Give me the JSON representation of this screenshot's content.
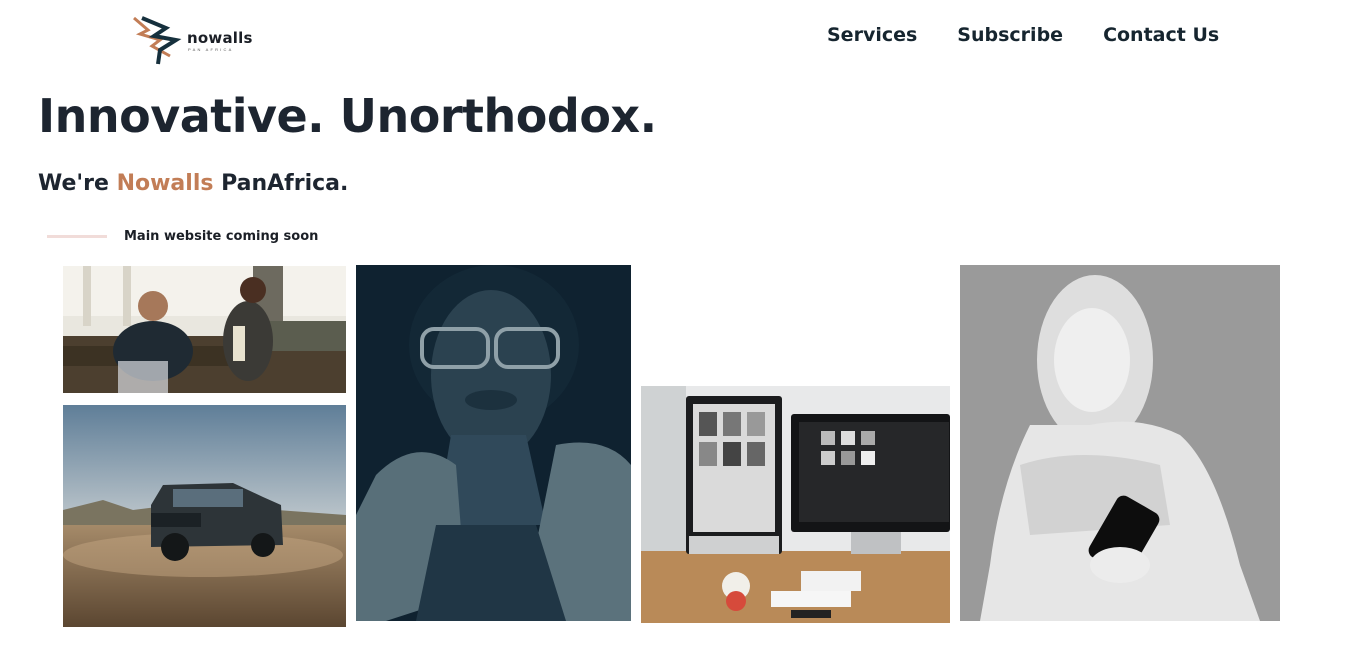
{
  "brand": {
    "name": "nowalls",
    "tagline": "PAN AFRICA"
  },
  "nav": {
    "items": [
      "Services",
      "Subscribe",
      "Contact Us"
    ]
  },
  "hero": {
    "headline": "Innovative. Unorthodox.",
    "sub_prefix": "We're ",
    "sub_accent": "Nowalls",
    "sub_suffix": " PanAfrica.",
    "notice": "Main website coming soon"
  },
  "colors": {
    "text": "#1d2530",
    "accent": "#c27d56",
    "divider": "#f1dcd9"
  },
  "gallery": [
    {
      "name": "office-meeting-image"
    },
    {
      "name": "suv-desert-image"
    },
    {
      "name": "portrait-woman-glasses-image"
    },
    {
      "name": "desk-monitors-image"
    },
    {
      "name": "statue-phone-image"
    }
  ]
}
